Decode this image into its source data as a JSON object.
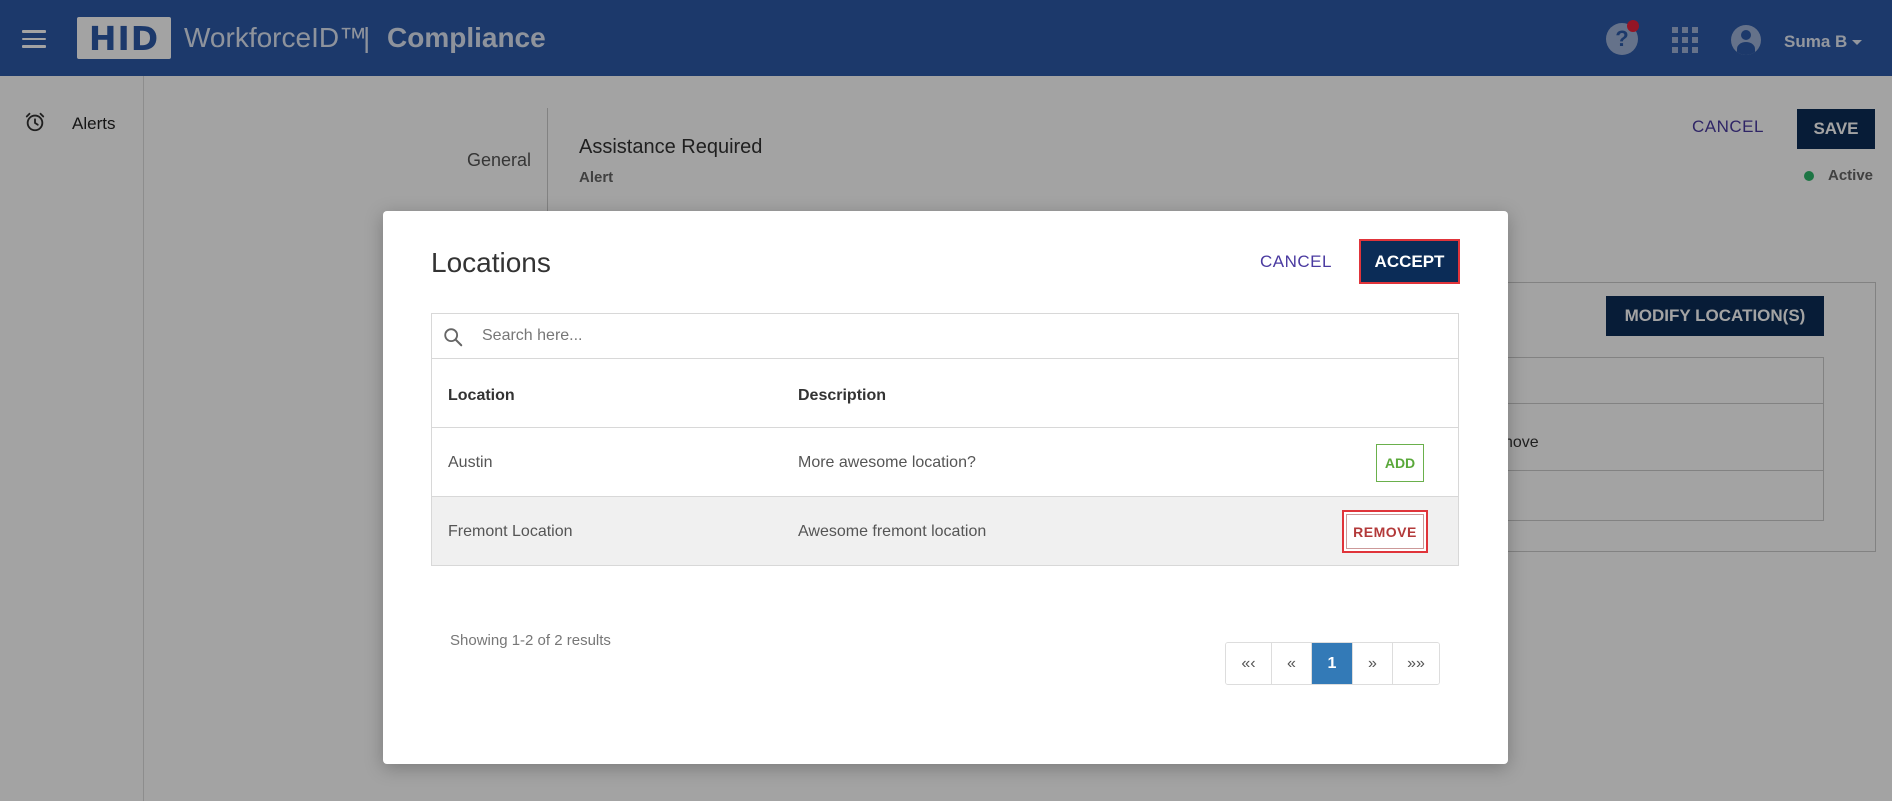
{
  "header": {
    "logo_text": "HID",
    "product_name": "WorkforceID™",
    "separator": "|",
    "app_name": "Compliance",
    "help_icon": "?",
    "user_name": "Suma B",
    "colors": {
      "bar": "#2c5aa8",
      "notification": "#e8213a"
    }
  },
  "sidebar": {
    "items": [
      {
        "label": "Alerts",
        "icon": "alarm-clock-icon"
      }
    ]
  },
  "background": {
    "section_label": "General",
    "alert_title": "Assistance Required",
    "alert_type": "Alert",
    "cancel_label": "CANCEL",
    "save_label": "SAVE",
    "status": "Active",
    "modify_label": "MODIFY LOCATION(S)",
    "row_remove_fragment": "nove"
  },
  "modal": {
    "title": "Locations",
    "cancel_label": "CANCEL",
    "accept_label": "ACCEPT",
    "search": {
      "placeholder": "Search here...",
      "value": ""
    },
    "table": {
      "columns": [
        "Location",
        "Description"
      ],
      "rows": [
        {
          "location": "Austin",
          "description": "More awesome location?",
          "action": "ADD"
        },
        {
          "location": "Fremont Location",
          "description": "Awesome fremont location",
          "action": "REMOVE"
        }
      ]
    },
    "results_text": "Showing 1-2 of 2 results",
    "pagination": {
      "first": "«‹",
      "prev": "«",
      "current": "1",
      "next": "»",
      "last": "»»"
    }
  }
}
